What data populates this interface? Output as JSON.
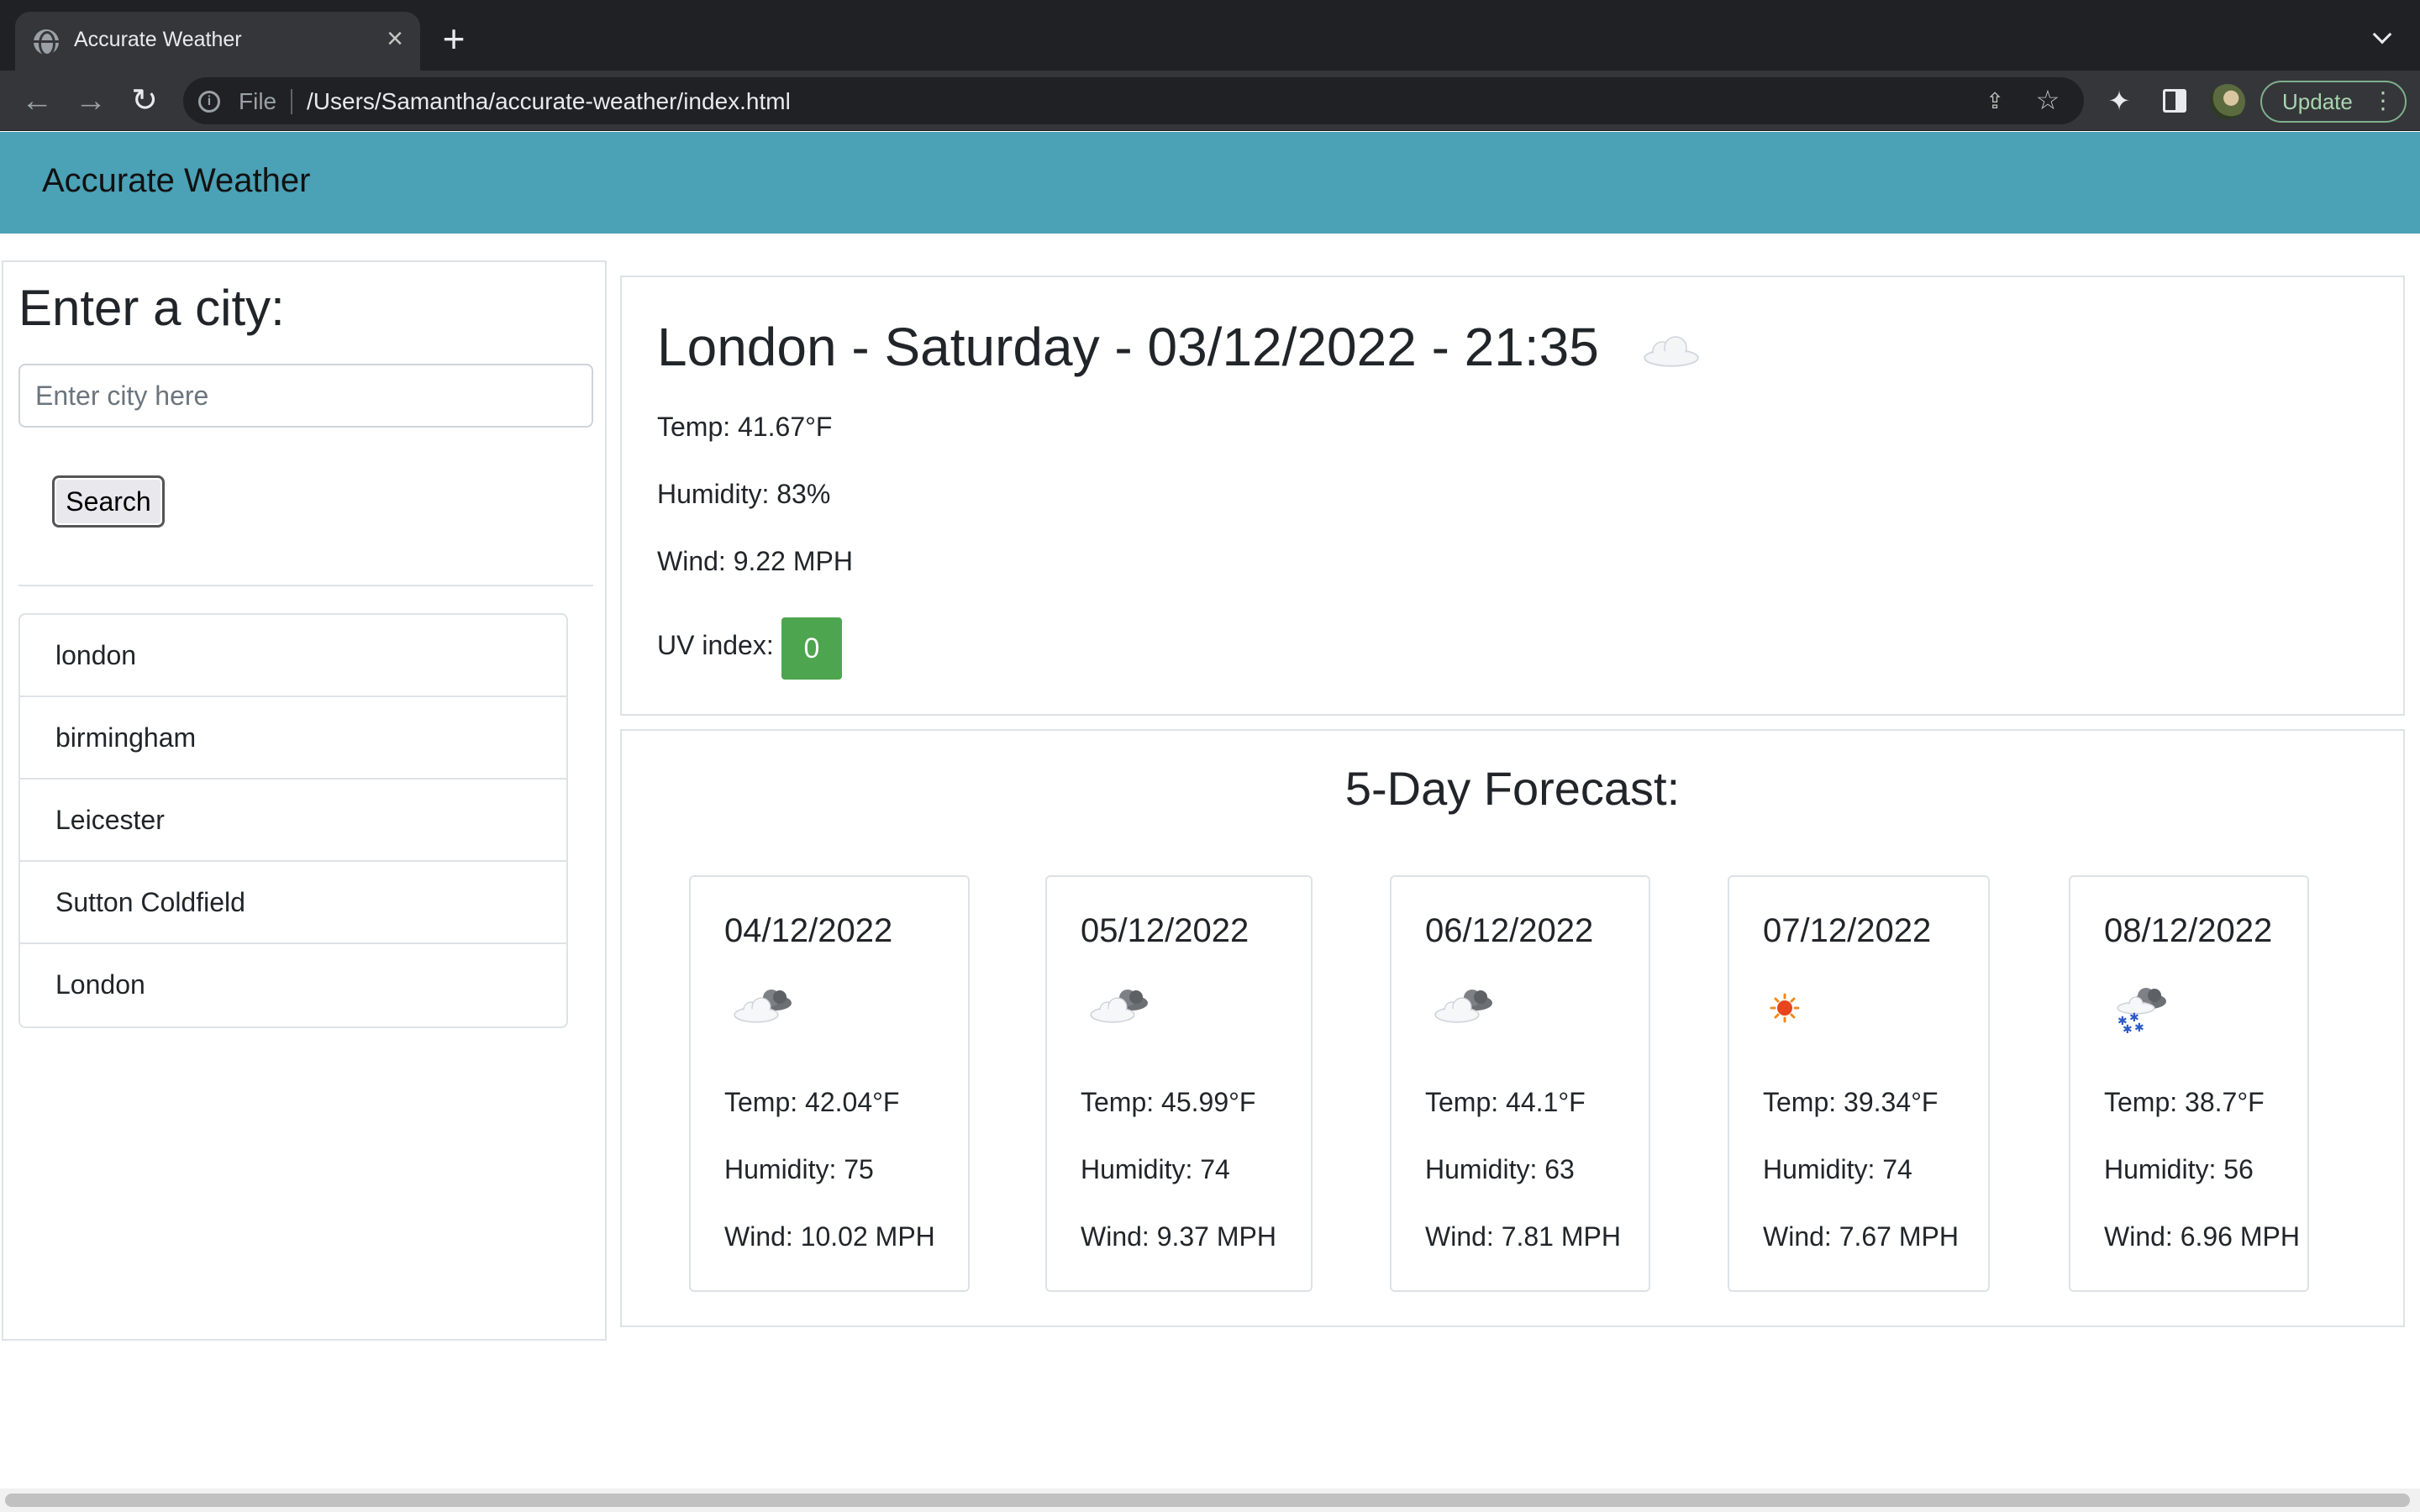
{
  "browser": {
    "tab_title": "Accurate Weather",
    "tab_close_icon": "close-icon",
    "new_tab_icon": "plus-icon",
    "url_scheme": "File",
    "url": "/Users/Samantha/accurate-weather/index.html",
    "update_label": "Update"
  },
  "header": {
    "brand": "Accurate Weather"
  },
  "search": {
    "heading": "Enter a city:",
    "placeholder": "Enter city here",
    "value": "",
    "button_label": "Search"
  },
  "history": [
    {
      "label": "london"
    },
    {
      "label": "birmingham"
    },
    {
      "label": "Leicester"
    },
    {
      "label": "Sutton Coldfield"
    },
    {
      "label": "London"
    }
  ],
  "current": {
    "title": "London - Saturday - 03/12/2022 - 21:35",
    "icon": "cloud-icon",
    "temp": "Temp: 41.67°F",
    "humidity": "Humidity: 83%",
    "wind": "Wind: 9.22 MPH",
    "uv_label": "UV index:",
    "uv_value": "0",
    "uv_color": "#4ea54f"
  },
  "forecast": {
    "heading": "5-Day Forecast:",
    "days": [
      {
        "date": "04/12/2022",
        "icon": "broken-clouds-icon",
        "temp": "Temp: 42.04°F",
        "humidity": "Humidity: 75",
        "wind": "Wind: 10.02 MPH"
      },
      {
        "date": "05/12/2022",
        "icon": "broken-clouds-icon",
        "temp": "Temp: 45.99°F",
        "humidity": "Humidity: 74",
        "wind": "Wind: 9.37 MPH"
      },
      {
        "date": "06/12/2022",
        "icon": "broken-clouds-icon",
        "temp": "Temp: 44.1°F",
        "humidity": "Humidity: 63",
        "wind": "Wind: 7.81 MPH"
      },
      {
        "date": "07/12/2022",
        "icon": "sun-icon",
        "temp": "Temp: 39.34°F",
        "humidity": "Humidity: 74",
        "wind": "Wind: 7.67 MPH"
      },
      {
        "date": "08/12/2022",
        "icon": "snow-icon",
        "temp": "Temp: 38.7°F",
        "humidity": "Humidity: 56",
        "wind": "Wind: 6.96 MPH"
      }
    ]
  },
  "colors": {
    "header_bg": "#4ba1b6",
    "uv_badge": "#4ea54f",
    "border": "#dee2e6"
  }
}
